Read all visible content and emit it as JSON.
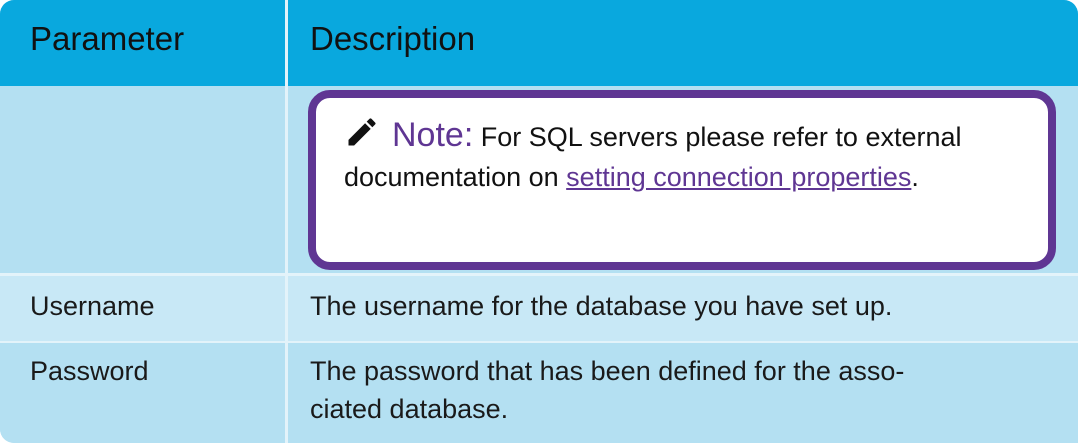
{
  "table": {
    "headers": {
      "parameter": "Parameter",
      "description": "Description"
    },
    "note": {
      "icon": "pencil-icon",
      "title": "Note",
      "colon": ":",
      "text_before": "For SQL servers please refer to external documentation on",
      "link_text": "setting connection properties",
      "text_after": "."
    },
    "rows": [
      {
        "parameter": "Username",
        "description": "The username for the database you have set up."
      },
      {
        "parameter": "Password",
        "description_line1": "The password that has been defined for the asso-",
        "description_line2": "ciated database."
      }
    ]
  },
  "colors": {
    "header_bg": "#09a8de",
    "row_bg": "#b4e0f2",
    "row_alt_bg": "#c8e8f6",
    "note_accent": "#5f3693"
  }
}
